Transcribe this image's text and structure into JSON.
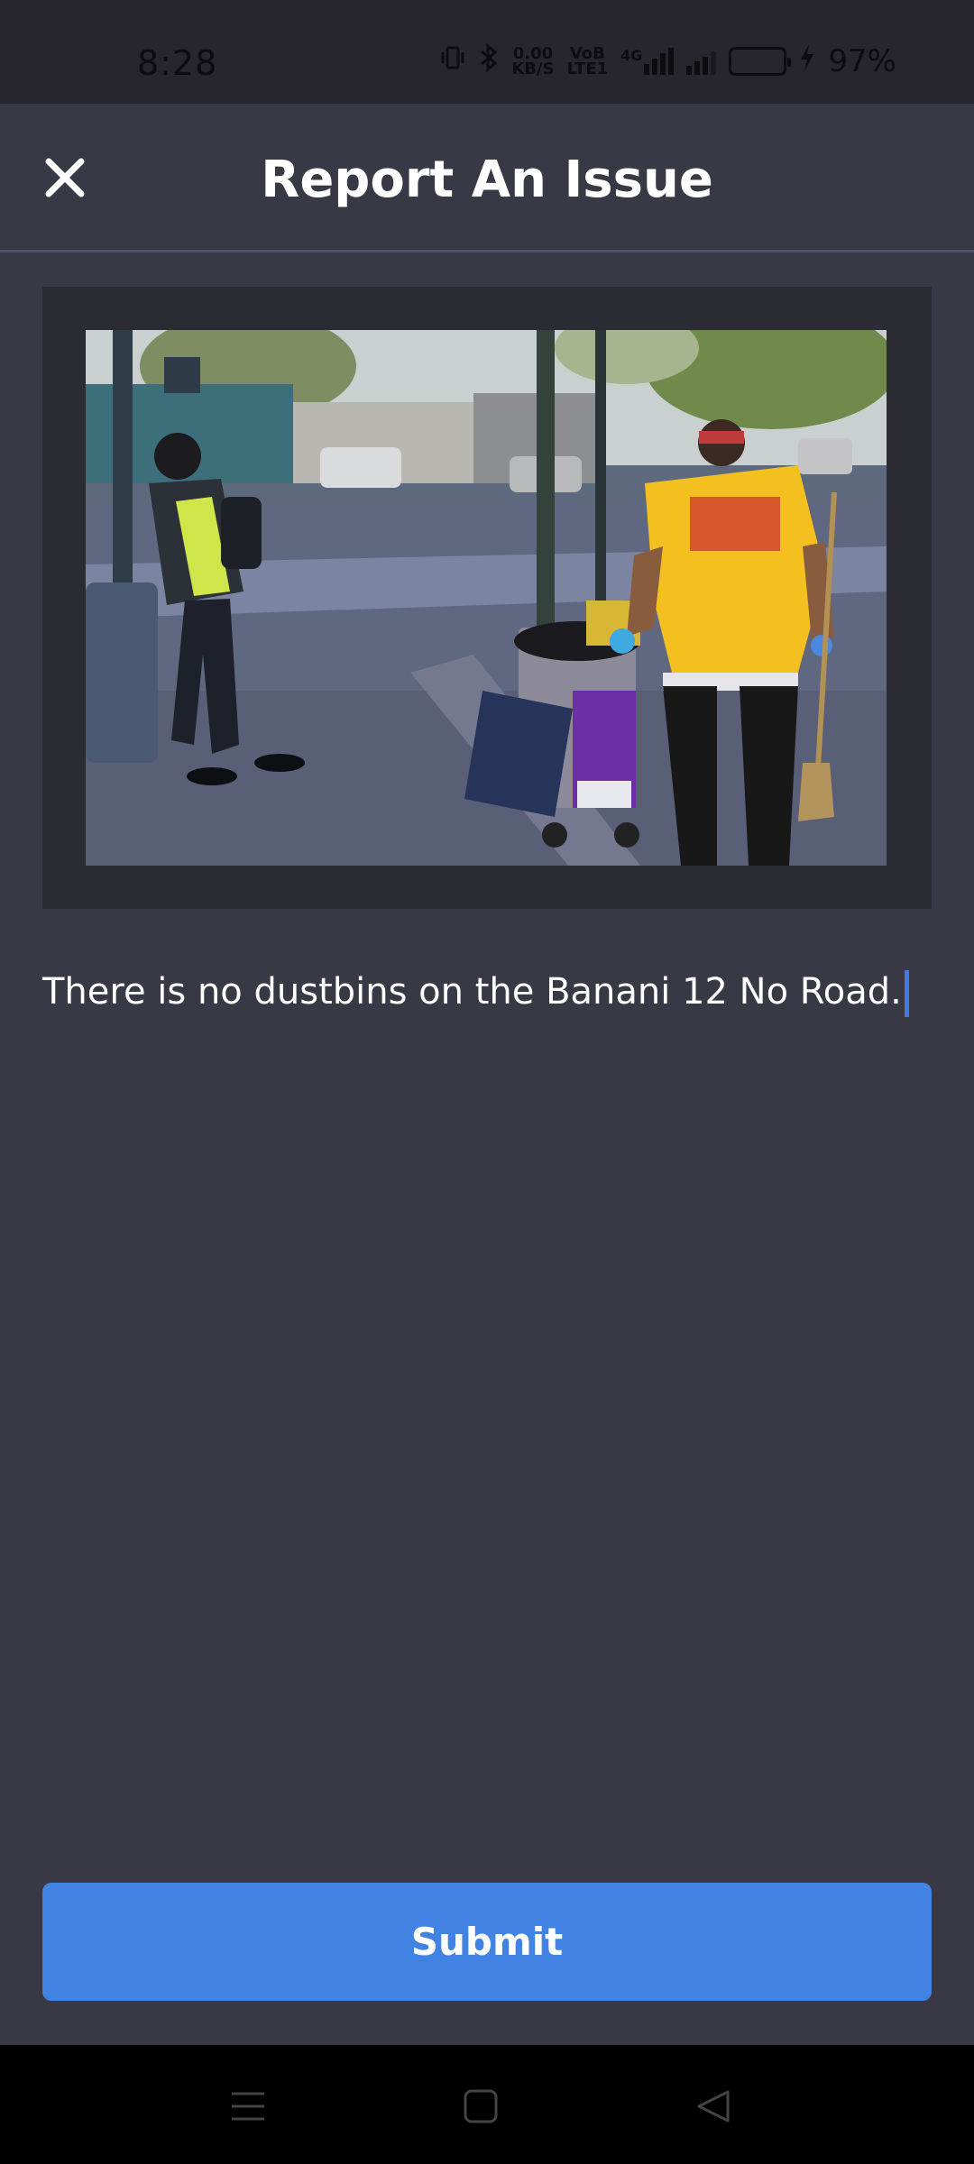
{
  "status_bar": {
    "time": "8:28",
    "net_speed_top": "0.00",
    "net_speed_bottom": "KB/S",
    "volte_top": "VoB",
    "volte_bottom": "LTE1",
    "network_type": "4G",
    "battery_percent": "97%",
    "battery_level": 0.97,
    "battery_color": "#e9ac14",
    "icons": [
      "vibrate-icon",
      "bluetooth-icon",
      "signal-icon",
      "battery-icon",
      "charging-icon"
    ]
  },
  "header": {
    "title": "Report An Issue",
    "close_icon": "close-icon"
  },
  "report": {
    "description": "There is no dustbins on the Banani 12 No Road."
  },
  "actions": {
    "submit_label": "Submit",
    "submit_color": "#4282e3"
  },
  "nav_bar": {
    "items": [
      "menu-icon",
      "home-icon",
      "back-icon"
    ]
  }
}
